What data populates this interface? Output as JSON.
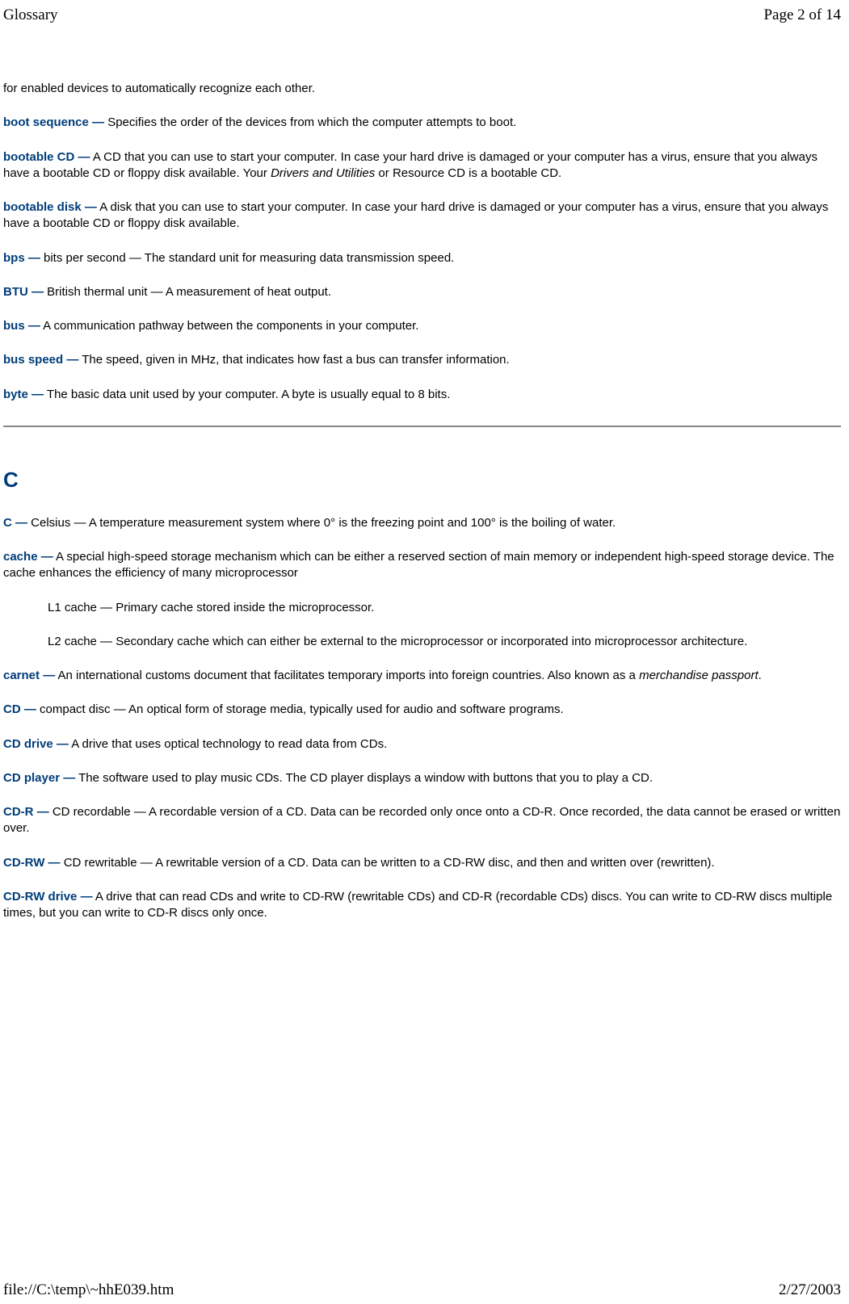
{
  "header": {
    "title": "Glossary",
    "page_info": "Page 2 of 14"
  },
  "footer": {
    "path": "file://C:\\temp\\~hhE039.htm",
    "date": "2/27/2003"
  },
  "intro_fragment": "for enabled devices to automatically recognize each other.",
  "entries_b": [
    {
      "term": "boot sequence —",
      "def": " Specifies the order of the devices from which the computer attempts to boot."
    },
    {
      "term": "bootable CD —",
      "def_pre": " A CD that you can use to start your computer. In case your hard drive is damaged or your computer has a virus, ensure that you always have a bootable CD or floppy disk available. Your ",
      "def_italic": "Drivers and Utilities",
      "def_post": " or Resource CD is a bootable CD."
    },
    {
      "term": "bootable disk —",
      "def": " A disk that you can use to start your computer. In case your hard drive is damaged or your computer has a virus, ensure that you always have a bootable CD or floppy disk available."
    },
    {
      "term": "bps —",
      "def": " bits per second — The standard unit for measuring data transmission speed."
    },
    {
      "term": "BTU —",
      "def": " British thermal unit — A measurement of heat output."
    },
    {
      "term": "bus —",
      "def": " A communication pathway between the components in your computer."
    },
    {
      "term": "bus speed —",
      "def": " The speed, given in MHz, that indicates how fast a bus can transfer information."
    },
    {
      "term": "byte —",
      "def": " The basic data unit used by your computer. A byte is usually equal to 8 bits."
    }
  ],
  "section_c": {
    "heading": "C",
    "entries": [
      {
        "term": "C —",
        "def": " Celsius — A temperature measurement system where 0° is the freezing point and 100° is the boiling of water."
      },
      {
        "term": "cache —",
        "def": " A special high-speed storage mechanism which can be either a reserved section of main memory or independent high-speed storage device. The cache enhances the efficiency of many microprocessor",
        "subs": [
          "L1 cache — Primary cache stored inside the microprocessor.",
          "L2 cache — Secondary cache which can either be external to the microprocessor or incorporated into microprocessor architecture."
        ]
      },
      {
        "term": "carnet —",
        "def_pre": " An international customs document that facilitates temporary imports into foreign countries. Also known as a ",
        "def_italic": "merchandise passport",
        "def_post": "."
      },
      {
        "term": "CD —",
        "def": " compact disc — An optical form of storage media, typically used for audio and software programs."
      },
      {
        "term": "CD drive —",
        "def": " A drive that uses optical technology to read data from CDs."
      },
      {
        "term": "CD player —",
        "def": " The software used to play music CDs. The CD player displays a window with buttons that you to play a CD."
      },
      {
        "term": "CD-R —",
        "def": " CD recordable — A recordable version of a CD. Data can be recorded only once onto a CD-R. Once recorded, the data cannot be erased or written over."
      },
      {
        "term": "CD-RW —",
        "def": " CD rewritable — A rewritable version of a CD. Data can be written to a CD-RW disc, and then and written over (rewritten)."
      },
      {
        "term": "CD-RW drive —",
        "def": " A drive that can read CDs and write to CD-RW (rewritable CDs) and CD-R (recordable CDs) discs. You can write to CD-RW discs multiple times, but you can write to CD-R discs only once."
      }
    ]
  }
}
